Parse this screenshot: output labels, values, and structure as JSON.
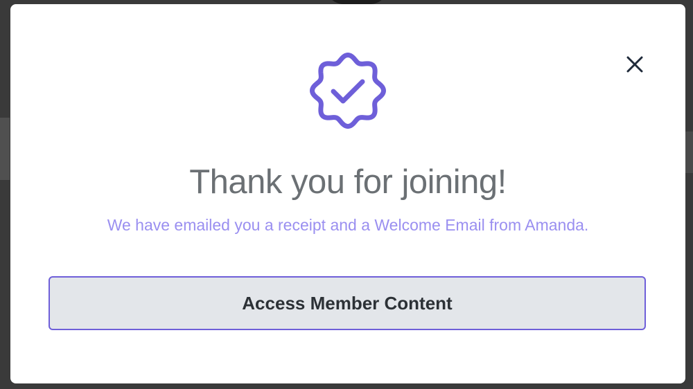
{
  "dialog": {
    "title": "Thank you for joining!",
    "message": "We have emailed you a receipt and a Welcome Email from Amanda.",
    "primary_button_label": "Access Member Content",
    "icons": {
      "badge": "verified-badge-icon",
      "close": "close-icon"
    },
    "colors": {
      "accent": "#6e5fd9",
      "message_text": "#9a8ff0",
      "title_text": "#6b7074",
      "button_background": "#e3e6ea",
      "button_text": "#2c3136",
      "close_icon": "#1f2a3a"
    }
  }
}
